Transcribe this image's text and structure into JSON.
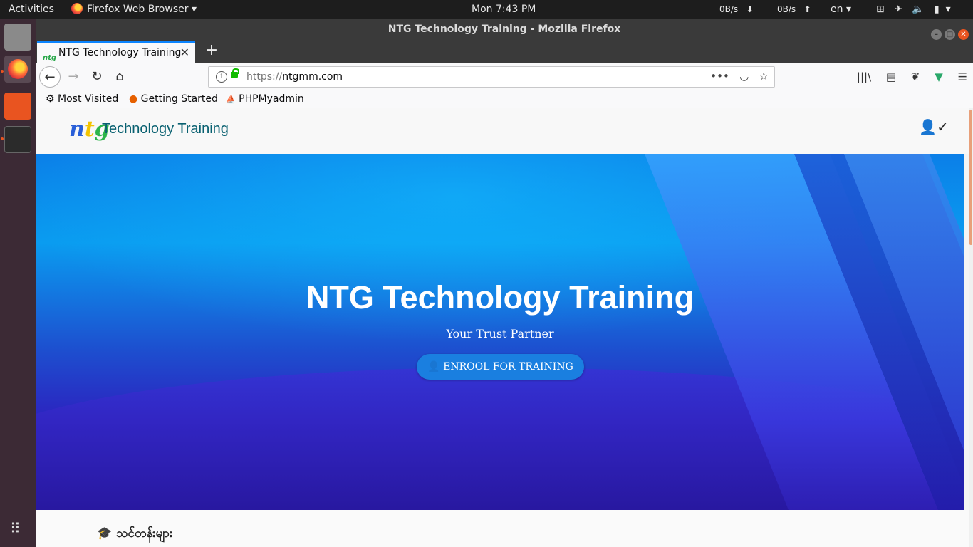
{
  "topbar": {
    "activities": "Activities",
    "app_name": "Firefox Web Browser",
    "clock": "Mon  7:43 PM",
    "net_down": "0B/s",
    "net_up": "0B/s",
    "lang": "en"
  },
  "window": {
    "title": "NTG Technology Training - Mozilla Firefox"
  },
  "tab": {
    "title": "NTG Technology Training",
    "close": "✕",
    "new_tab": "+"
  },
  "nav": {
    "url_scheme": "https://",
    "url_host": "ntgmm.com",
    "more": "•••"
  },
  "bookmarks": [
    {
      "label": "Most Visited",
      "icon": "gear-icon"
    },
    {
      "label": "Getting Started",
      "icon": "firefox-icon"
    },
    {
      "label": "PHPMyadmin",
      "icon": "phpmyadmin-icon"
    }
  ],
  "site": {
    "logo_text": "ntg",
    "brand": "Technology Training",
    "hero_title": "NTG Technology Training",
    "hero_subtitle": "Your Trust Partner",
    "cta_label": "ENROOL FOR TRAINING",
    "section_label": "သင်တန်းများ"
  },
  "colors": {
    "accent": "#0a84ff",
    "ubuntu_orange": "#e95420",
    "cta": "#1a7fe0",
    "brand_text": "#086070"
  }
}
